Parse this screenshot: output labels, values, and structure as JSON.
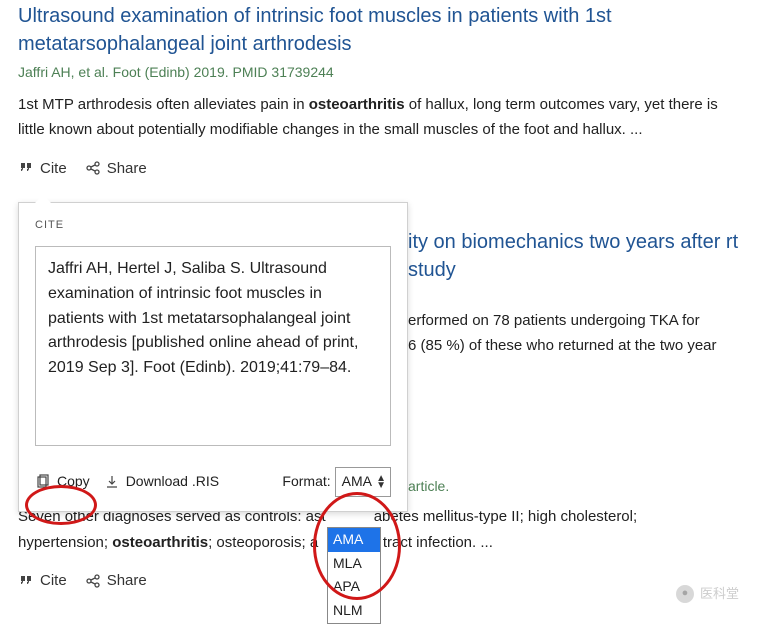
{
  "articles": [
    {
      "title": "Ultrasound examination of intrinsic foot muscles in patients with 1st metatarsophalangeal joint arthrodesis",
      "citation": "Jaffri AH, et al. Foot (Edinb) 2019. PMID 31739244",
      "snippet_pre": "1st MTP arthrodesis often alleviates pain in ",
      "snippet_bold": "osteoarthritis",
      "snippet_post": " of hallux, long term outcomes vary, yet there is little known about potentially modifiable changes in the small muscles of the foot and hallux. ..."
    },
    {
      "title_vis": "ity on biomechanics two years after rt study",
      "snippet_vis_line1": "erformed on 78 patients undergoing TKA for",
      "snippet_vis_line2": "6 (85 %) of these who returned at the two year"
    },
    {
      "free_label": " article.",
      "snippet_pre1": "Seven other diagnoses served as controls: ast",
      "snippet_mid1": "abetes mellitus-type II; high cholesterol;",
      "snippet_pre2": "hypertension; ",
      "snippet_bold": "osteoarthritis",
      "snippet_post2": "; osteoporosis; a",
      "snippet_mid2": "ry tract infection. ..."
    }
  ],
  "actions": {
    "cite": "Cite",
    "share": "Share"
  },
  "popup": {
    "label": "CITE",
    "text": "Jaffri AH, Hertel J, Saliba S. Ultrasound examination of intrinsic foot muscles in patients with 1st metatarsophalangeal joint arthrodesis [published online ahead of print, 2019 Sep 3]. Foot (Edinb). 2019;41:79–84.",
    "copy": "Copy",
    "download": "Download .RIS",
    "format_label": "Format:",
    "format_selected": "AMA",
    "format_options": [
      "AMA",
      "MLA",
      "APA",
      "NLM"
    ]
  },
  "watermark": "医科堂"
}
